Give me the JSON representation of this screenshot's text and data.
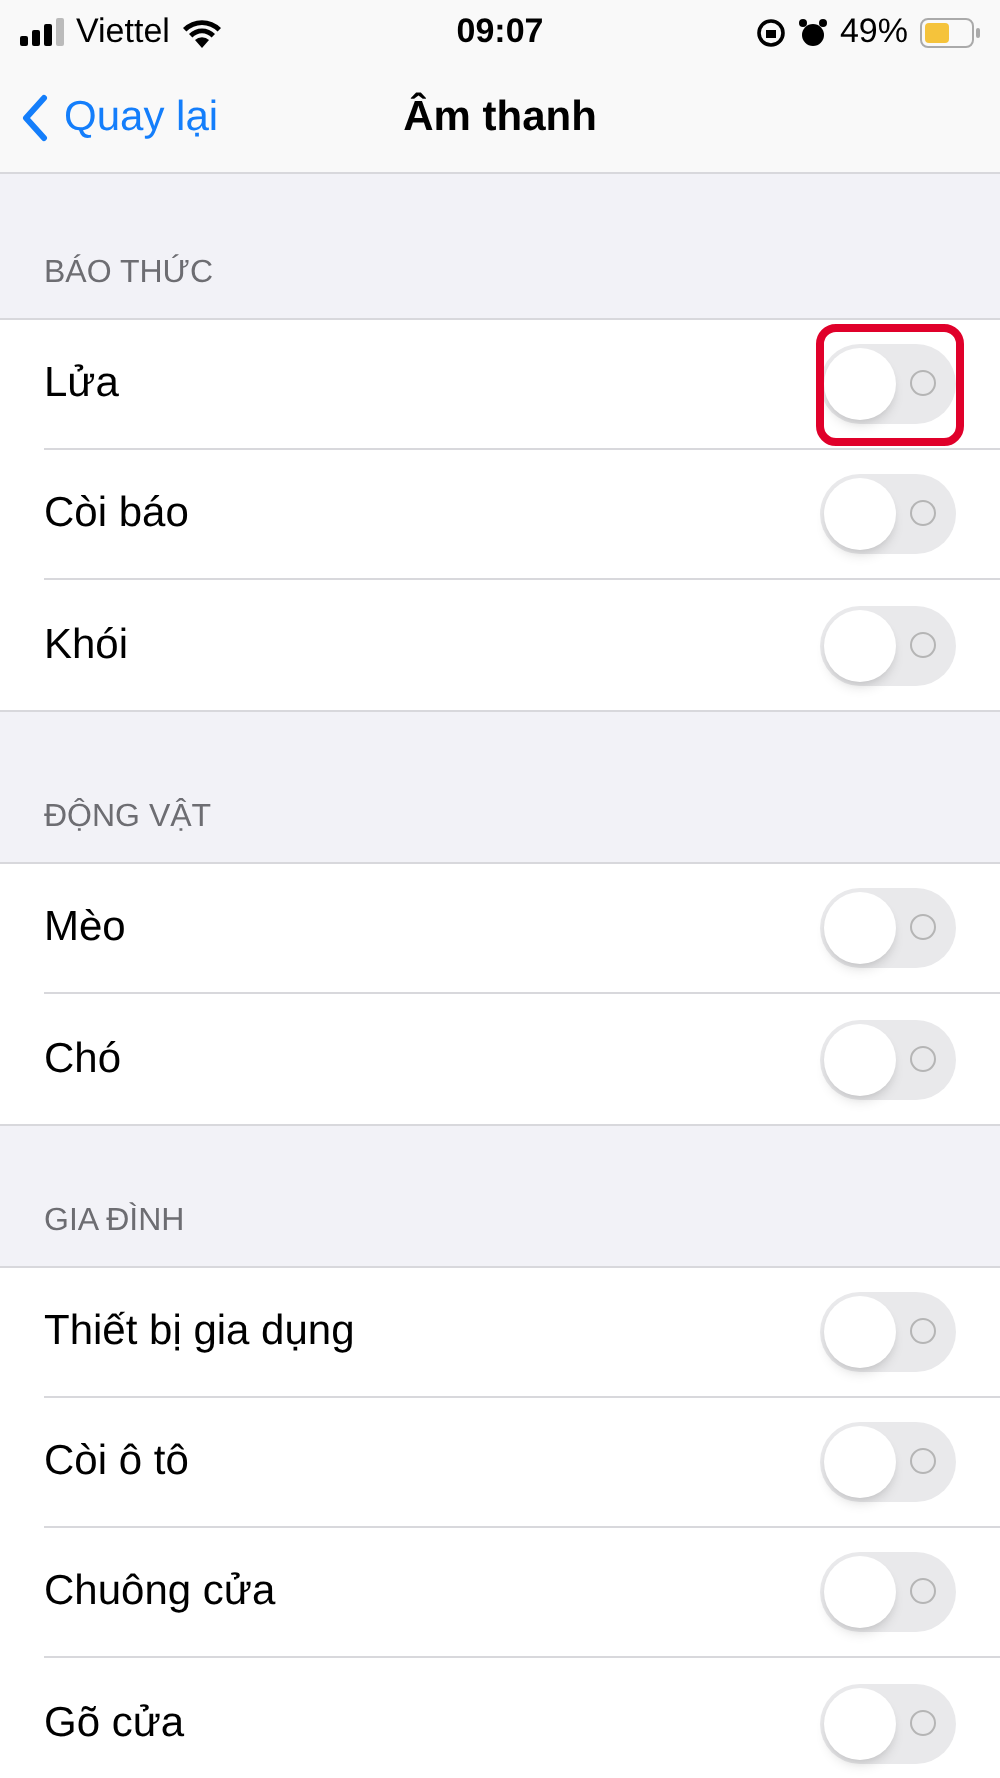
{
  "status_bar": {
    "carrier": "Viettel",
    "time": "09:07",
    "battery": "49%"
  },
  "nav": {
    "back": "Quay lại",
    "title": "Âm thanh"
  },
  "sections": [
    {
      "header": "BÁO THỨC",
      "rows": [
        {
          "label": "Lửa",
          "on": false,
          "highlighted": true
        },
        {
          "label": "Còi báo",
          "on": false,
          "highlighted": false
        },
        {
          "label": "Khói",
          "on": false,
          "highlighted": false
        }
      ]
    },
    {
      "header": "ĐỘNG VẬT",
      "rows": [
        {
          "label": "Mèo",
          "on": false,
          "highlighted": false
        },
        {
          "label": "Chó",
          "on": false,
          "highlighted": false
        }
      ]
    },
    {
      "header": "GIA ĐÌNH",
      "rows": [
        {
          "label": "Thiết bị gia dụng",
          "on": false,
          "highlighted": false
        },
        {
          "label": "Còi ô tô",
          "on": false,
          "highlighted": false
        },
        {
          "label": "Chuông cửa",
          "on": false,
          "highlighted": false
        },
        {
          "label": "Gõ cửa",
          "on": false,
          "highlighted": false
        }
      ]
    }
  ]
}
